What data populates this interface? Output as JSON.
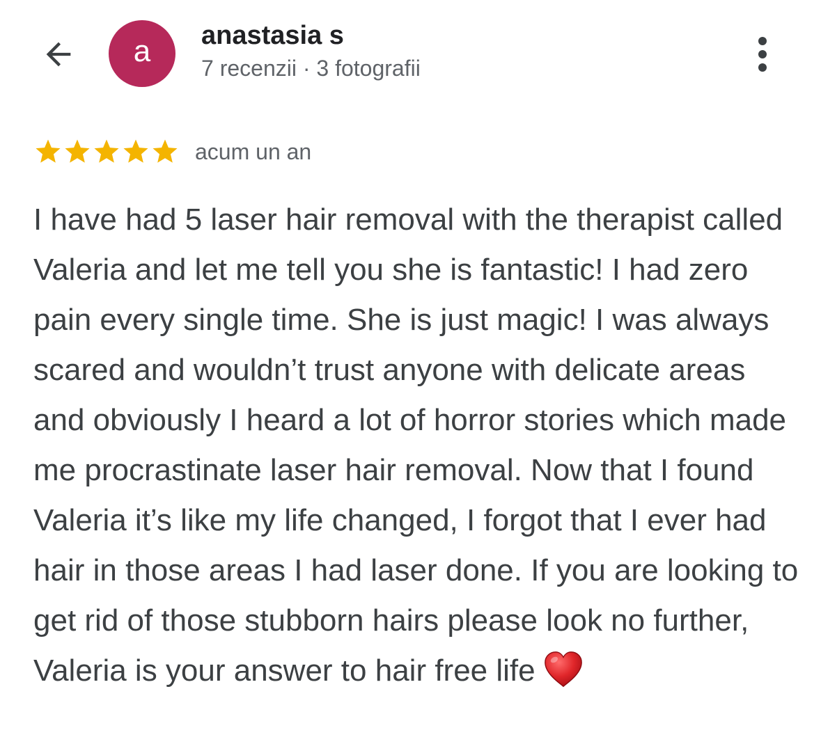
{
  "header": {
    "back_icon": "arrow-left-icon",
    "avatar": {
      "letter": "a",
      "color": "#B6295A"
    },
    "user_name": "anastasia s",
    "user_stats": "7 recenzii · 3 fotografii",
    "more_icon": "more-vert-icon"
  },
  "review": {
    "rating": 5,
    "max_rating": 5,
    "star_color": "#F4B400",
    "time": "acum un an",
    "text": "I have had 5 laser hair removal with the therapist called Valeria and let me tell you she is fantastic! I had zero pain every single time. She is just magic! I was always scared and wouldn’t trust anyone with delicate areas and obviously I heard a lot of horror stories which made me procrastinate laser hair removal. Now that I found Valeria it’s like my life changed, I forgot that I ever had hair in those areas I had laser done. If you are looking to get rid of those stubborn hairs please look no further, Valeria is your answer to hair free life",
    "emoji_icon": "red-heart-icon"
  }
}
